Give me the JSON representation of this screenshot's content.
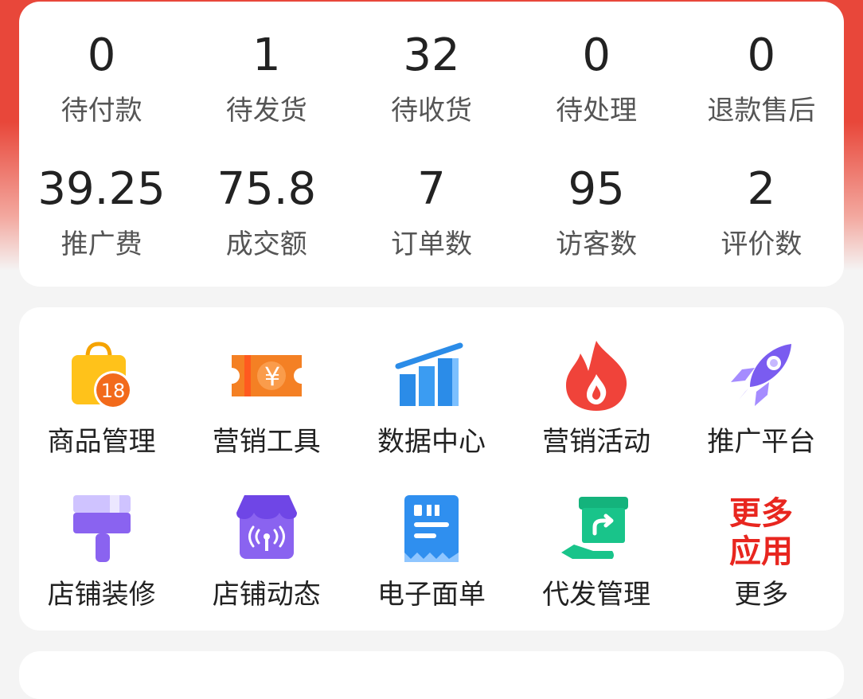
{
  "stats": {
    "row1": [
      {
        "value": "0",
        "label": "待付款"
      },
      {
        "value": "1",
        "label": "待发货"
      },
      {
        "value": "32",
        "label": "待收货"
      },
      {
        "value": "0",
        "label": "待处理"
      },
      {
        "value": "0",
        "label": "退款售后"
      }
    ],
    "row2": [
      {
        "value": "39.25",
        "label": "推广费"
      },
      {
        "value": "75.8",
        "label": "成交额"
      },
      {
        "value": "7",
        "label": "订单数"
      },
      {
        "value": "95",
        "label": "访客数"
      },
      {
        "value": "2",
        "label": "评价数"
      }
    ]
  },
  "apps": {
    "row1": [
      {
        "label": "商品管理",
        "icon": "shopping-bag-icon",
        "badge": "18"
      },
      {
        "label": "营销工具",
        "icon": "coupon-icon",
        "glyph": "¥"
      },
      {
        "label": "数据中心",
        "icon": "bar-chart-icon"
      },
      {
        "label": "营销活动",
        "icon": "flame-icon"
      },
      {
        "label": "推广平台",
        "icon": "rocket-icon"
      }
    ],
    "row2": [
      {
        "label": "店铺装修",
        "icon": "paint-roller-icon"
      },
      {
        "label": "店铺动态",
        "icon": "storefront-broadcast-icon"
      },
      {
        "label": "电子面单",
        "icon": "receipt-icon"
      },
      {
        "label": "代发管理",
        "icon": "hand-box-icon"
      },
      {
        "label": "更多",
        "icon": "more-apps-icon",
        "icon_text": [
          "更多",
          "应用"
        ]
      }
    ]
  },
  "colors": {
    "header_red": "#e8473a",
    "bag_yellow": "#ffc21a",
    "badge_orange": "#f26a1b",
    "coupon_orange": "#f48024",
    "chart_blue": "#2b8ce8",
    "flame_red": "#f0433a",
    "rocket_purple": "#7a5cf0",
    "receipt_blue": "#2f8fef",
    "box_green": "#19c48a",
    "more_red": "#e8261f"
  }
}
